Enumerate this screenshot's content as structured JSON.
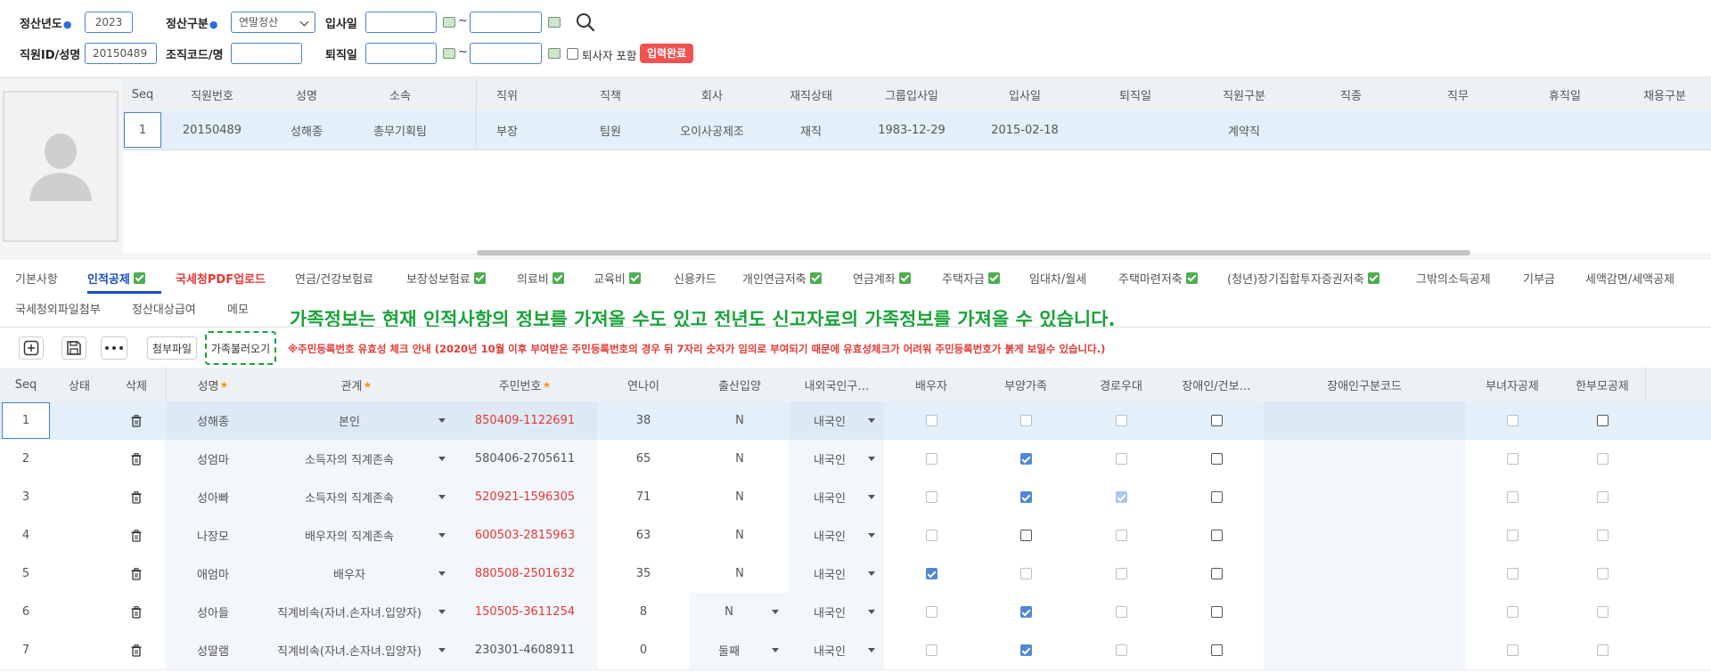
{
  "search": {
    "year_label": "정산년도",
    "year_value": "2023",
    "type_label": "정산구분",
    "type_value": "연말정산",
    "hire_label": "입사일",
    "emp_label": "직원ID/성명",
    "emp_value": "20150489",
    "org_label": "조직코드/명",
    "leave_label": "퇴직일",
    "include_retired": "퇴사자 포함",
    "input_done": "입력완료",
    "tilde": "~"
  },
  "employee_grid": {
    "headers": [
      "Seq",
      "직원번호",
      "성명",
      "소속",
      "직위",
      "직책",
      "회사",
      "재직상태",
      "그룹입사일",
      "입사일",
      "퇴직일",
      "직원구분",
      "직종",
      "직무",
      "휴직일",
      "채용구분"
    ],
    "row": [
      "1",
      "20150489",
      "성해종",
      "총무기획팀",
      "부장",
      "팀원",
      "오이사공제조",
      "재직",
      "1983-12-29",
      "2015-02-18",
      "",
      "계약직",
      "",
      "",
      "",
      ""
    ]
  },
  "tabs": {
    "row1": [
      {
        "label": "기본사항",
        "check": false,
        "style": "normal"
      },
      {
        "label": "인적공제",
        "check": true,
        "style": "active"
      },
      {
        "label": "국세청PDF업로드",
        "check": false,
        "style": "red"
      },
      {
        "label": "연금/건강보험료",
        "check": false,
        "style": "normal"
      },
      {
        "label": "보장성보험료",
        "check": true,
        "style": "normal"
      },
      {
        "label": "의료비",
        "check": true,
        "style": "normal"
      },
      {
        "label": "교육비",
        "check": true,
        "style": "normal"
      },
      {
        "label": "신용카드",
        "check": false,
        "style": "normal"
      },
      {
        "label": "개인연금저축",
        "check": true,
        "style": "normal"
      },
      {
        "label": "연금계좌",
        "check": true,
        "style": "normal"
      },
      {
        "label": "주택자금",
        "check": true,
        "style": "normal"
      },
      {
        "label": "임대차/월세",
        "check": false,
        "style": "normal"
      },
      {
        "label": "주택마련저축",
        "check": true,
        "style": "normal"
      },
      {
        "label": "(청년)장기집합투자증권저축",
        "check": true,
        "style": "normal"
      },
      {
        "label": "그밖의소득공제",
        "check": false,
        "style": "normal"
      },
      {
        "label": "기부금",
        "check": false,
        "style": "normal"
      },
      {
        "label": "세액감면/세액공제",
        "check": false,
        "style": "normal"
      }
    ],
    "row2": [
      {
        "label": "국세청외파일첨부"
      },
      {
        "label": "정산대상급여"
      },
      {
        "label": "메모"
      }
    ],
    "annotation": "가족정보는 현재 인적사항의 정보를 가져올 수도 있고 전년도 신고자료의 가족정보를 가져올 수 있습니다."
  },
  "toolbar": {
    "attach_label": "첨부파일",
    "load_family_label": "가족불러오기",
    "notice": "※주민등록번호 유효성 체크 안내 (2020년 10월 이후 부여받은 주민등록번호의 경우 뒤 7자리 숫자가 임의로 부여되기 때문에 유효성체크가 어려워 주민등록번호가 붉게 보일수 있습니다.)"
  },
  "family_grid": {
    "headers": [
      "Seq",
      "상태",
      "삭제",
      "성명",
      "관계",
      "주민번호",
      "연나이",
      "출산입양",
      "내외국인구…",
      "배우자",
      "부양가족",
      "경로우대",
      "장애인/건보…",
      "장애인구분코드",
      "부녀자공제",
      "한부모공제"
    ],
    "rows": [
      {
        "seq": "1",
        "name": "성해종",
        "relation": "본인",
        "rrn": "850409-1122691",
        "rrn_red": true,
        "age": "38",
        "birth": "N",
        "birth_dd": false,
        "nat": "내국인",
        "spouse": false,
        "dependent": false,
        "senior": false,
        "senior_light": false,
        "disabled": false
      },
      {
        "seq": "2",
        "name": "성엄마",
        "relation": "소득자의 직계존속",
        "rrn": "580406-2705611",
        "rrn_red": false,
        "age": "65",
        "birth": "N",
        "birth_dd": false,
        "nat": "내국인",
        "spouse": false,
        "dependent": true,
        "senior": false,
        "senior_light": false,
        "disabled": false
      },
      {
        "seq": "3",
        "name": "성아빠",
        "relation": "소득자의 직계존속",
        "rrn": "520921-1596305",
        "rrn_red": true,
        "age": "71",
        "birth": "N",
        "birth_dd": false,
        "nat": "내국인",
        "spouse": false,
        "dependent": true,
        "senior": true,
        "senior_light": true,
        "disabled": false
      },
      {
        "seq": "4",
        "name": "나장모",
        "relation": "배우자의 직계존속",
        "rrn": "600503-2815963",
        "rrn_red": true,
        "age": "63",
        "birth": "N",
        "birth_dd": false,
        "nat": "내국인",
        "spouse": false,
        "dependent": false,
        "senior": false,
        "senior_light": false,
        "disabled": false
      },
      {
        "seq": "5",
        "name": "애엄마",
        "relation": "배우자",
        "rrn": "880508-2501632",
        "rrn_red": true,
        "age": "35",
        "birth": "N",
        "birth_dd": false,
        "nat": "내국인",
        "spouse": true,
        "dependent": false,
        "senior": false,
        "senior_light": false,
        "disabled": false
      },
      {
        "seq": "6",
        "name": "성아들",
        "relation": "직계비속(자녀.손자녀.입양자)",
        "rrn": "150505-3611254",
        "rrn_red": true,
        "age": "8",
        "birth": "N",
        "birth_dd": true,
        "nat": "내국인",
        "spouse": false,
        "dependent": true,
        "senior": false,
        "senior_light": false,
        "disabled": false
      },
      {
        "seq": "7",
        "name": "성딸램",
        "relation": "직계비속(자녀.손자녀.입양자)",
        "rrn": "230301-4608911",
        "rrn_red": false,
        "age": "0",
        "birth": "둘째",
        "birth_dd": true,
        "nat": "내국인",
        "spouse": false,
        "dependent": true,
        "senior": false,
        "senior_light": false,
        "disabled": false
      }
    ]
  },
  "colors": {
    "accent_blue": "#1c4fbf",
    "red": "#e53935",
    "green": "#1aa33a",
    "check_blue": "#4f89d8",
    "selected_row": "#e3f0f9"
  }
}
